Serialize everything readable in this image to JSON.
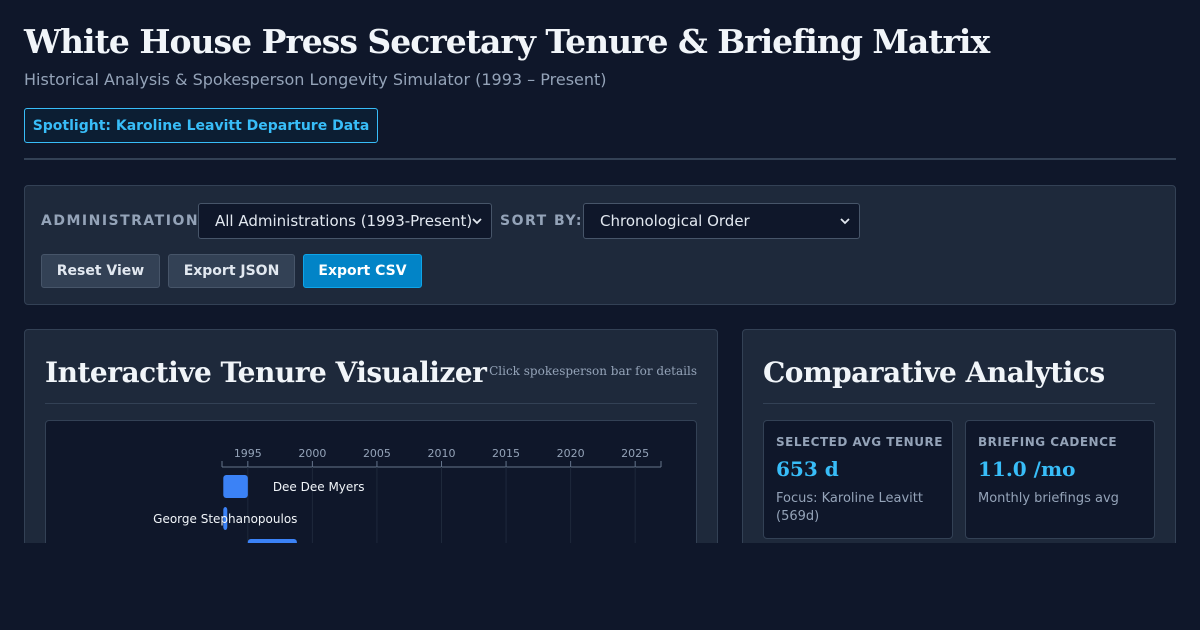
{
  "header": {
    "title": "White House Press Secretary Tenure & Briefing Matrix",
    "subtitle": "Historical Analysis & Spokesperson Longevity Simulator (1993 – Present)",
    "spotlight_label": "Spotlight: Karoline Leavitt Departure Data"
  },
  "controls": {
    "administration_label": "ADMINISTRATION:",
    "administration_value": "All Administrations (1993-Present)",
    "sort_label": "SORT BY:",
    "sort_value": "Chronological Order",
    "buttons": {
      "reset": "Reset View",
      "export_json": "Export JSON",
      "export_csv": "Export CSV"
    }
  },
  "visualizer": {
    "title": "Interactive Tenure Visualizer",
    "hint": "Click spokesperson bar for details"
  },
  "analytics": {
    "title": "Comparative Analytics",
    "avg_tenure": {
      "label": "SELECTED AVG TENURE",
      "value": "653 d",
      "note": "Focus: Karoline Leavitt (569d)"
    },
    "briefing_cadence": {
      "label": "BRIEFING CADENCE",
      "value": "11.0 /mo",
      "note": "Monthly briefings avg"
    }
  },
  "colors": {
    "bar": "#3b82f6",
    "accent": "#38bdf8",
    "primary_button": "#0284c7"
  },
  "chart_data": {
    "type": "bar",
    "orientation": "horizontal-timeline",
    "x_axis": {
      "ticks": [
        "1995",
        "2000",
        "2005",
        "2010",
        "2015",
        "2020",
        "2025"
      ],
      "range": [
        1993,
        2027
      ]
    },
    "series": [
      {
        "name": "Dee Dee Myers",
        "start": 1993.1,
        "end": 1995.0
      },
      {
        "name": "George Stephanopoulos",
        "start": 1993.1,
        "end": 1993.4
      },
      {
        "name": "",
        "start": 1995.0,
        "end": 1998.8
      }
    ]
  }
}
